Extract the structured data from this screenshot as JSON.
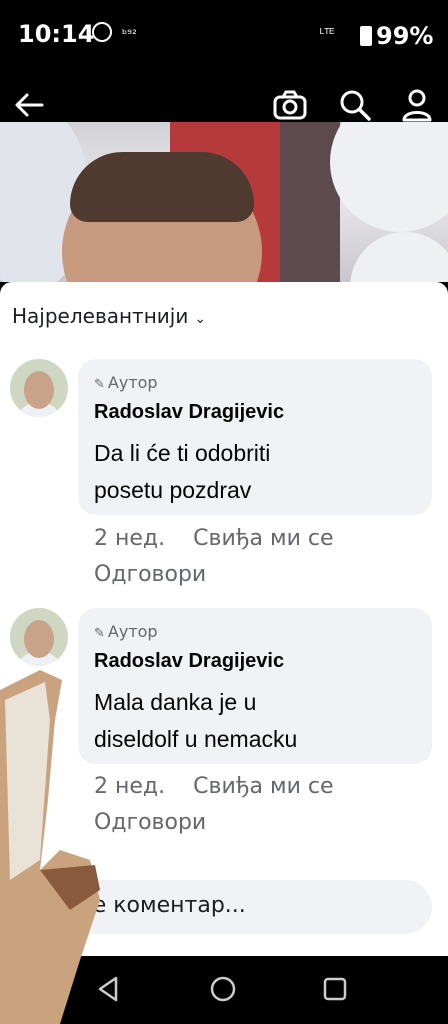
{
  "status_bar": {
    "time": "10:14",
    "network": "ᵇ⁹²",
    "signal": "ᴸᵀᴱ",
    "battery": "99%"
  },
  "header": {
    "icons": [
      "back-arrow-icon",
      "camera-icon",
      "search-icon",
      "profile-icon"
    ]
  },
  "sort": {
    "label": "Најрелевантнији",
    "chevron": "⌄"
  },
  "comments": [
    {
      "author_badge": "Аутор",
      "name": "Radoslav Dragijevic",
      "lines": [
        "Da li će ti odobriti",
        "posetu pozdrav"
      ],
      "time": "2 нед.",
      "like": "Свиђа ми се",
      "reply": "Одговори"
    },
    {
      "author_badge": "Аутор",
      "name": "Radoslav Dragijevic",
      "lines": [
        "Mala danka je u",
        "diseldolf u nemacku"
      ],
      "time": "2 нед.",
      "like": "Свиђа ми се",
      "reply": "Одговори"
    }
  ],
  "composer": {
    "placeholder": "есите коментар..."
  },
  "colors": {
    "bubble": "#f0f2f5",
    "meta_text": "#65676b",
    "name_text": "#050505"
  }
}
